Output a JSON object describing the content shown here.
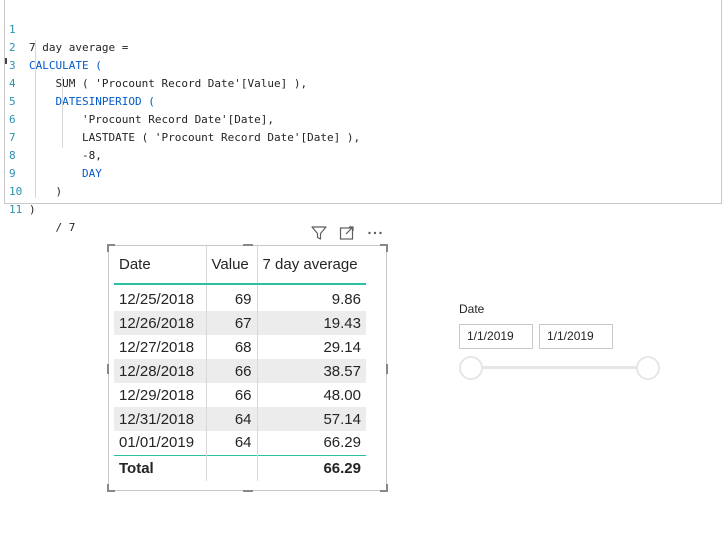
{
  "editor": {
    "lines": [
      {
        "num": "1",
        "text": "7 day average ="
      },
      {
        "num": "2",
        "text": "CALCULATE ("
      },
      {
        "num": "3",
        "text": "    SUM ( 'Procount Record Date'[Value] ),"
      },
      {
        "num": "4",
        "text": "    DATESINPERIOD ("
      },
      {
        "num": "5",
        "text": "        'Procount Record Date'[Date],"
      },
      {
        "num": "6",
        "text": "        LASTDATE ( 'Procount Record Date'[Date] ),"
      },
      {
        "num": "7",
        "text": "        -8,"
      },
      {
        "num": "8",
        "text": "        DAY"
      },
      {
        "num": "9",
        "text": "    )"
      },
      {
        "num": "10",
        "text": ")"
      },
      {
        "num": "11",
        "text": "    / 7"
      }
    ],
    "keyword_color": "#035aca"
  },
  "visual_header": {
    "icons": [
      "filter-icon",
      "focus-mode-icon",
      "more-options-icon"
    ]
  },
  "table": {
    "headers": [
      "Date",
      "Value",
      "7 day average"
    ],
    "rows": [
      [
        "12/25/2018",
        "69",
        "9.86"
      ],
      [
        "12/26/2018",
        "67",
        "19.43"
      ],
      [
        "12/27/2018",
        "68",
        "29.14"
      ],
      [
        "12/28/2018",
        "66",
        "38.57"
      ],
      [
        "12/29/2018",
        "66",
        "48.00"
      ],
      [
        "12/31/2018",
        "64",
        "57.14"
      ],
      [
        "01/01/2019",
        "64",
        "66.29"
      ]
    ],
    "total": {
      "label": "Total",
      "value": "",
      "avg": "66.29"
    },
    "accent_color": "#2bbfa4"
  },
  "slicer": {
    "title": "Date",
    "start": "1/1/2019",
    "end": "1/1/2019"
  }
}
